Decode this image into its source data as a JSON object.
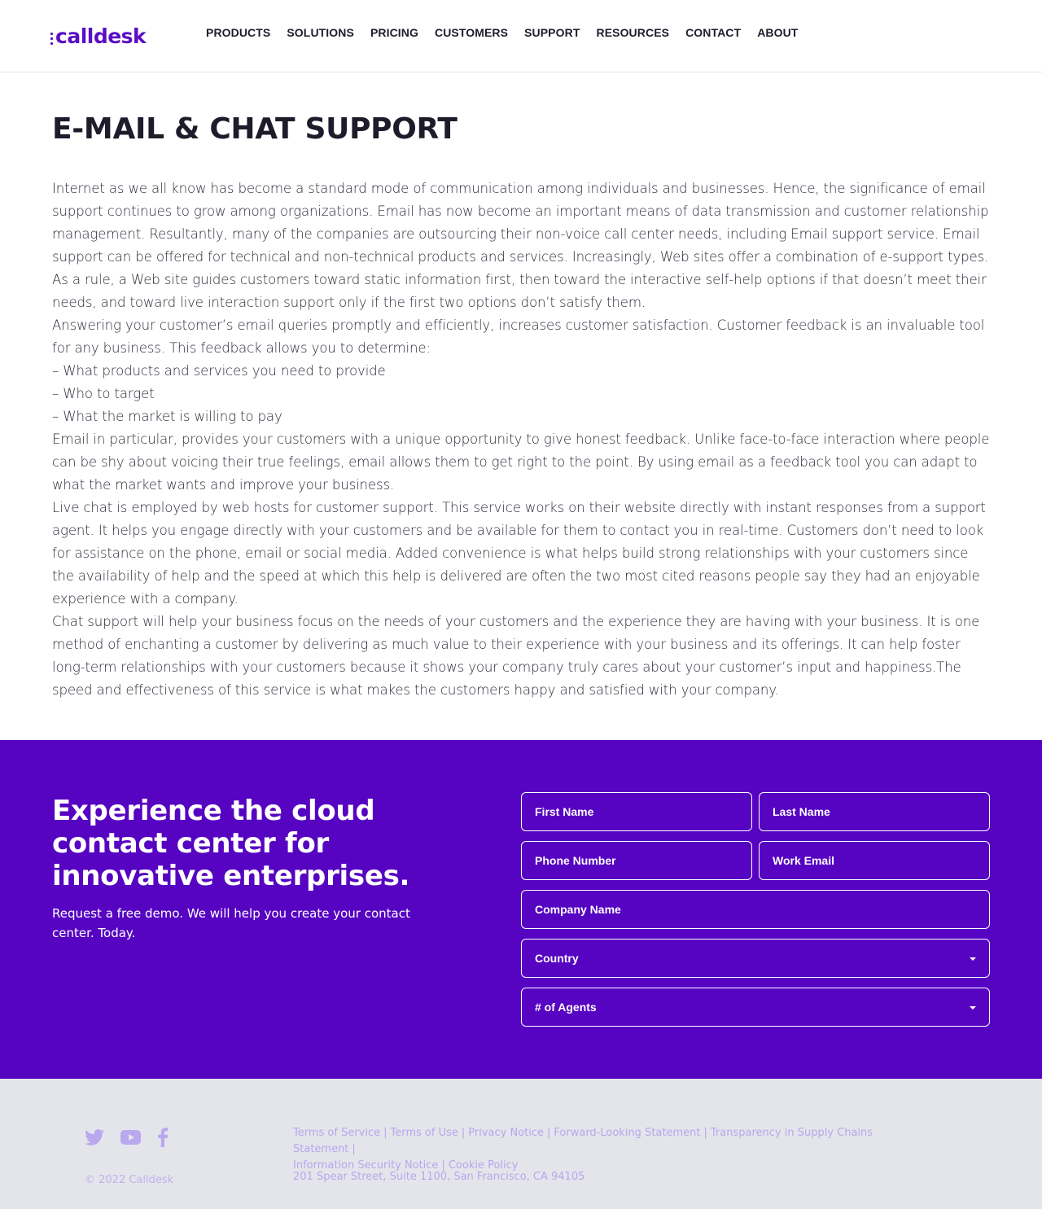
{
  "header": {
    "logo_text": "calldesk",
    "nav": [
      "PRODUCTS",
      "SOLUTIONS",
      "PRICING",
      "CUSTOMERS",
      "SUPPORT",
      "RESOURCES",
      "CONTACT",
      "ABOUT"
    ]
  },
  "article": {
    "title": "E-MAIL & CHAT SUPPORT",
    "paragraphs": [
      "Internet as we all know has become a standard mode of communication among individuals and businesses. Hence, the significance of email support continues to grow among organizations. Email has now become an important means of data transmission and customer relationship management. Resultantly, many of the companies are outsourcing their non-voice call center needs, including Email support service. Email support can be offered for technical and non-technical products and services. Increasingly, Web sites offer a combination of e-support types. As a rule, a Web site guides customers toward static information first, then toward the interactive self-help options if that doesn’t meet their needs, and toward live interaction support only if the first two options don’t satisfy them.",
      "Answering your customer’s email queries promptly and efficiently, increases customer satisfaction. Customer feedback is an invaluable tool for any business. This feedback allows you to determine:",
      "– What products and services you need to provide",
      "– Who to target",
      "– What the market is willing to pay",
      "Email in particular, provides your customers with a unique opportunity to give honest feedback. Unlike face-to-face interaction where people can be shy about voicing their true feelings, email allows them to get right to the point. By using email as a feedback tool you can adapt to what the market wants and improve your business.",
      "Live chat is employed by web hosts for customer support. This service works on their website directly with instant responses from a support agent. It helps you engage directly with your customers and be available for them to contact you in real-time. Customers don’t need to look for assistance on the phone, email or social media. Added convenience is what helps build strong relationships with your customers since the availability of help and the speed at which this help is delivered are often the two most cited reasons people say they had an enjoyable experience with a company.",
      "Chat support will help your business focus on the needs of your customers and the experience they are having with your business. It is one method of enchanting a customer by delivering as much value to their experience with your business and its offerings. It can help foster long-term relationships with your customers because it shows your company truly cares about your customer’s input and happiness.The speed and effectiveness of this service is what makes the customers happy and satisfied with your company."
    ]
  },
  "cta": {
    "heading": "Experience the cloud contact center for innovative enterprises.",
    "subtext": "Request a free demo. We will help you create your contact center. Today.",
    "form": {
      "first_name": "First Name",
      "last_name": "Last Name",
      "phone": "Phone Number",
      "email": "Work Email",
      "company": "Company Name",
      "country": "Country",
      "agents": "# of Agents"
    }
  },
  "footer": {
    "social_icons": [
      "twitter-icon",
      "youtube-icon",
      "facebook-icon"
    ],
    "copyright": "© 2022 Calldesk",
    "legal_links": [
      "Terms of Service",
      "Terms of Use",
      "Privacy Notice",
      "Forward-Looking Statement",
      "Transparency in Supply Chains Statement",
      "Information Security Notice",
      "Cookie Policy"
    ],
    "address": "201 Spear Street, Suite 1100, San Francisco, CA 94105"
  },
  "colors": {
    "brand": "#5a0ec4",
    "cta_bg": "#5603c2",
    "footer_bg": "#e4e5ea",
    "footer_text": "#b7a6ee"
  }
}
